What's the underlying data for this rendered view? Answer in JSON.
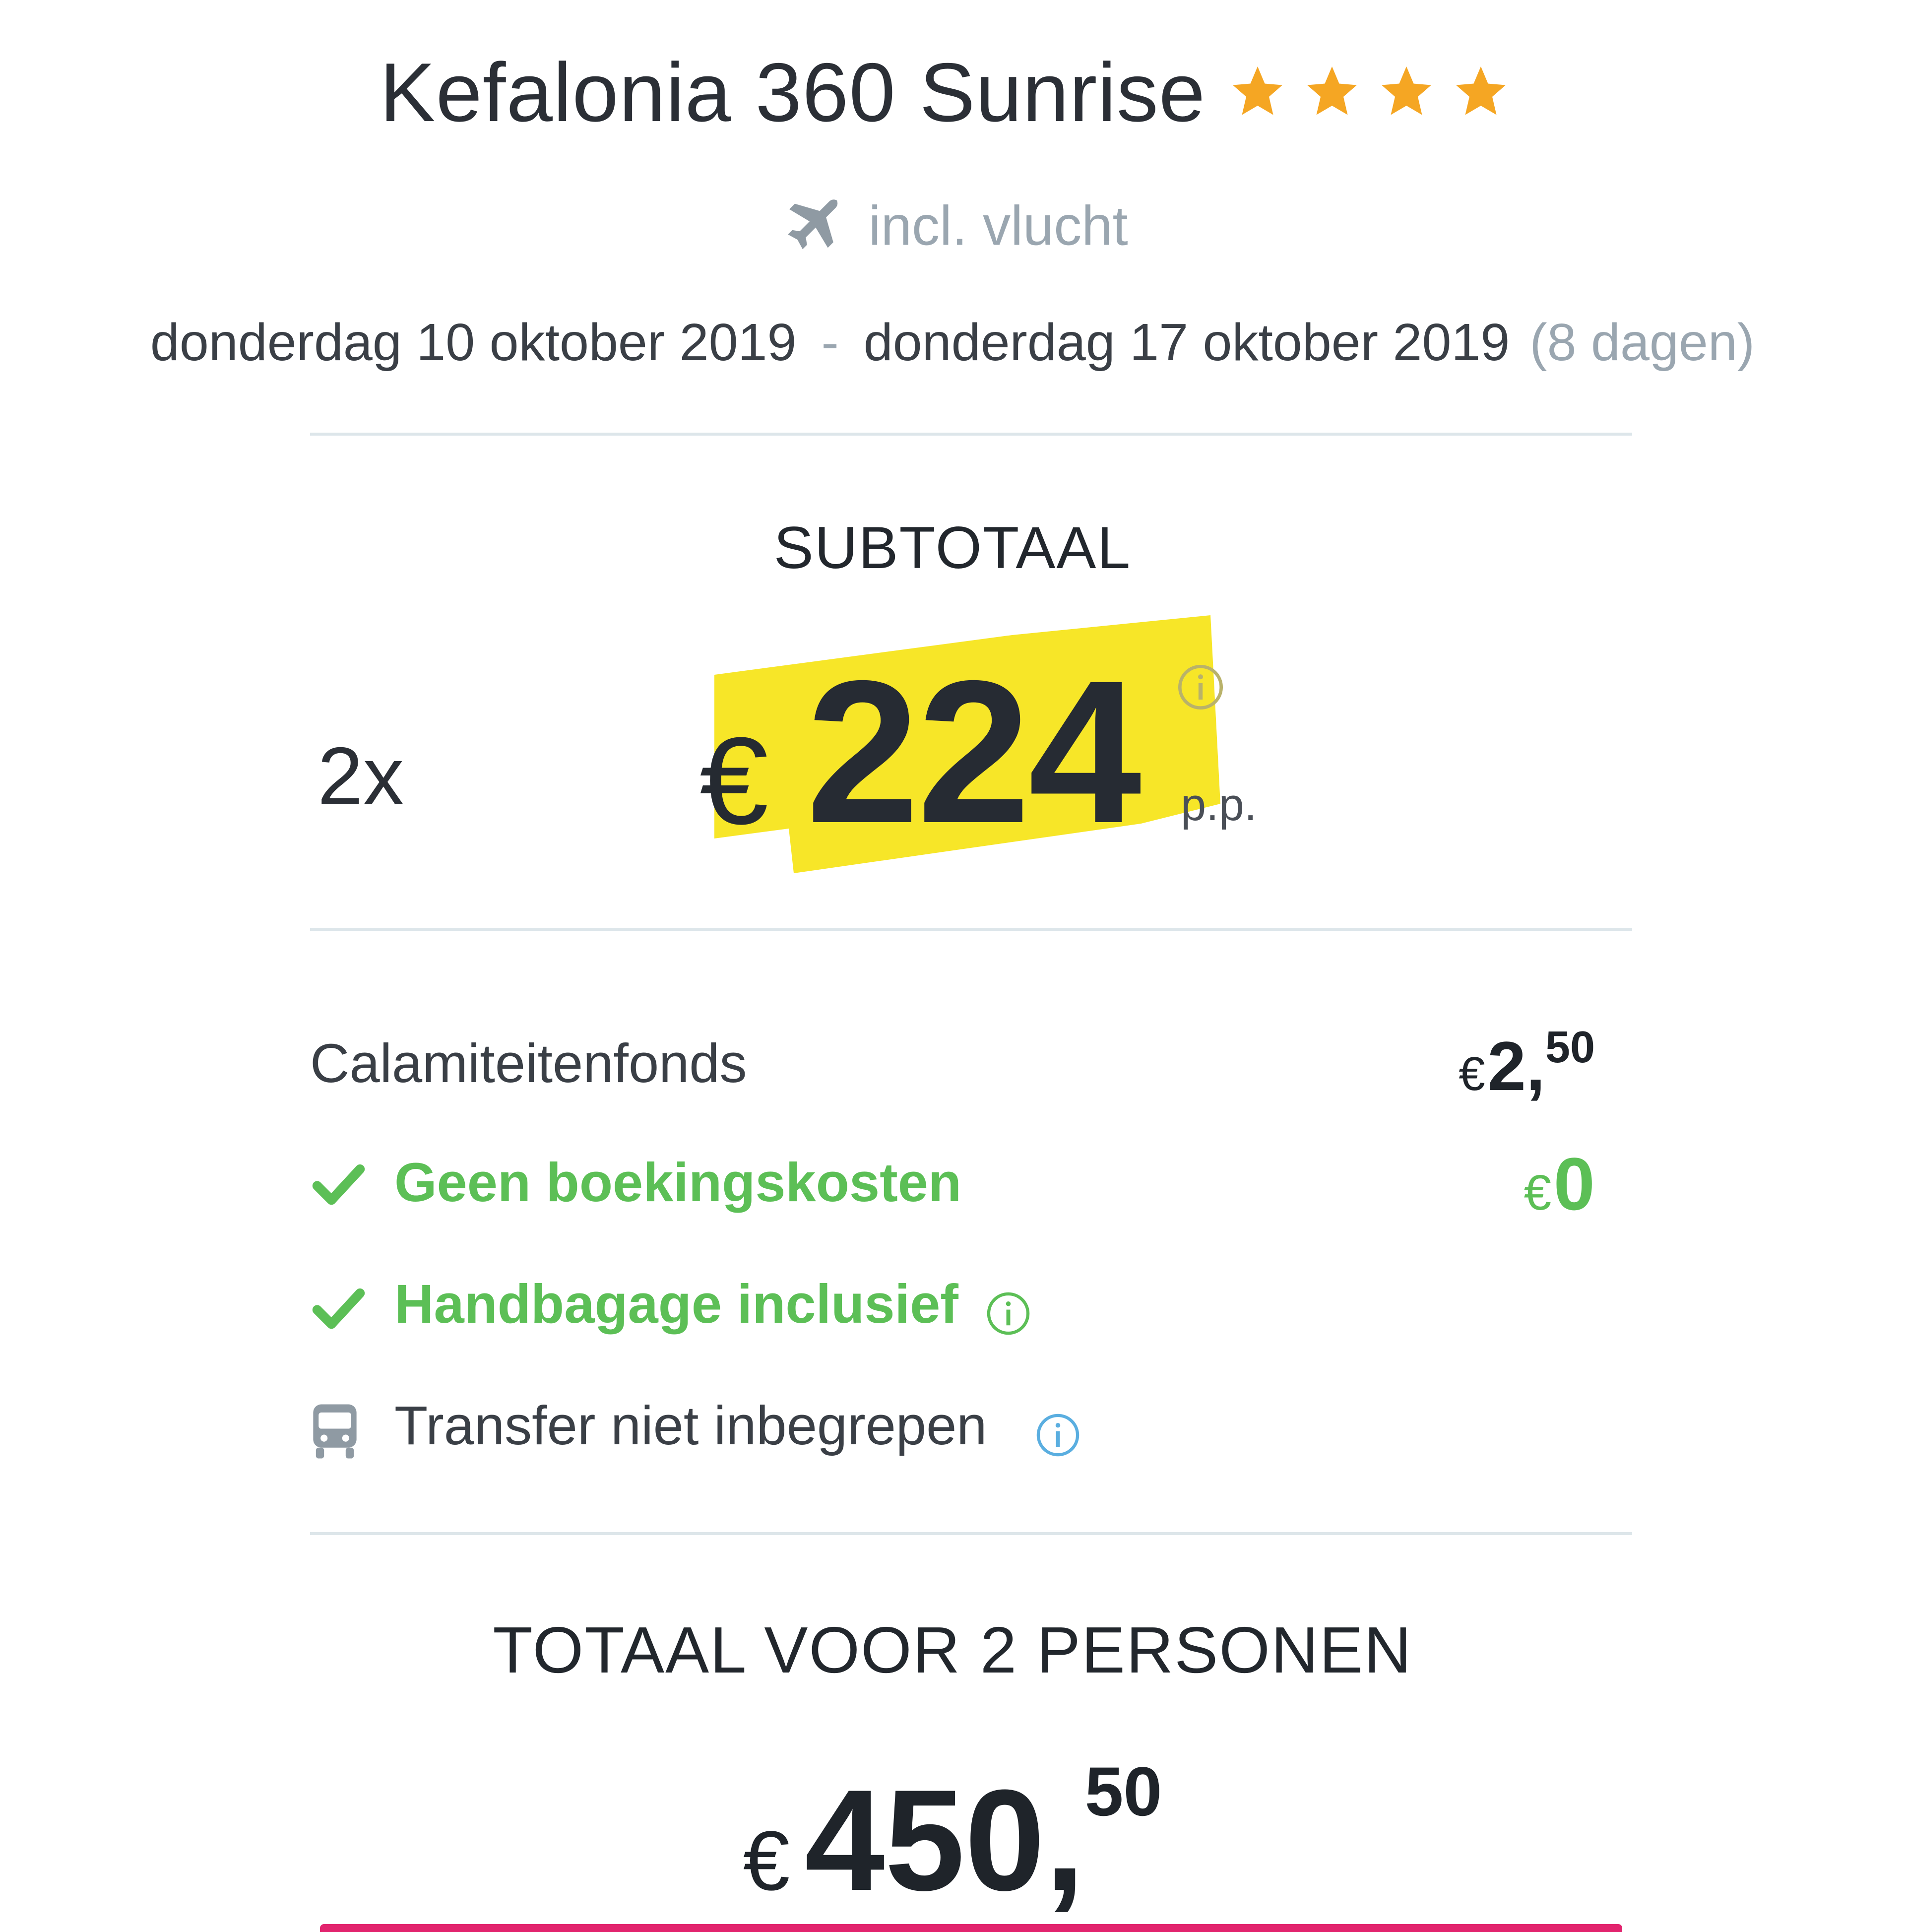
{
  "hotel": {
    "name": "Kefalonia 360 Sunrise",
    "stars": 4,
    "star_color": "#f5a623"
  },
  "flight": {
    "icon": "airplane-icon",
    "label": "incl. vlucht"
  },
  "dates": {
    "start": "donderdag 10 oktober 2019",
    "separator": "-",
    "end": "donderdag 17 oktober 2019",
    "duration": "(8 dagen)"
  },
  "subtotal": {
    "label": "SUBTOTAAL",
    "quantity": "2x",
    "currency": "€",
    "price": "224",
    "per_person": "p.p.",
    "highlight_color": "#f7e628"
  },
  "items": {
    "calamity_fund": {
      "label": "Calamiteitenfonds",
      "currency": "€",
      "amount_whole": "2,",
      "amount_cents": "50"
    },
    "booking_costs": {
      "label": "Geen boekingskosten",
      "icon": "check-icon",
      "currency": "€",
      "amount": "0"
    },
    "hand_luggage": {
      "label": "Handbagage inclusief",
      "icon": "check-icon"
    },
    "transfer": {
      "label": "Transfer niet inbegrepen",
      "icon": "bus-icon"
    },
    "accent_green": "#5cbf56",
    "info_blue": "#5aaee0"
  },
  "total": {
    "label": "TOTAAL VOOR 2 PERSONEN",
    "currency": "€",
    "amount_whole": "450,",
    "amount_cents": "50"
  },
  "brand_color": "#e2246e"
}
